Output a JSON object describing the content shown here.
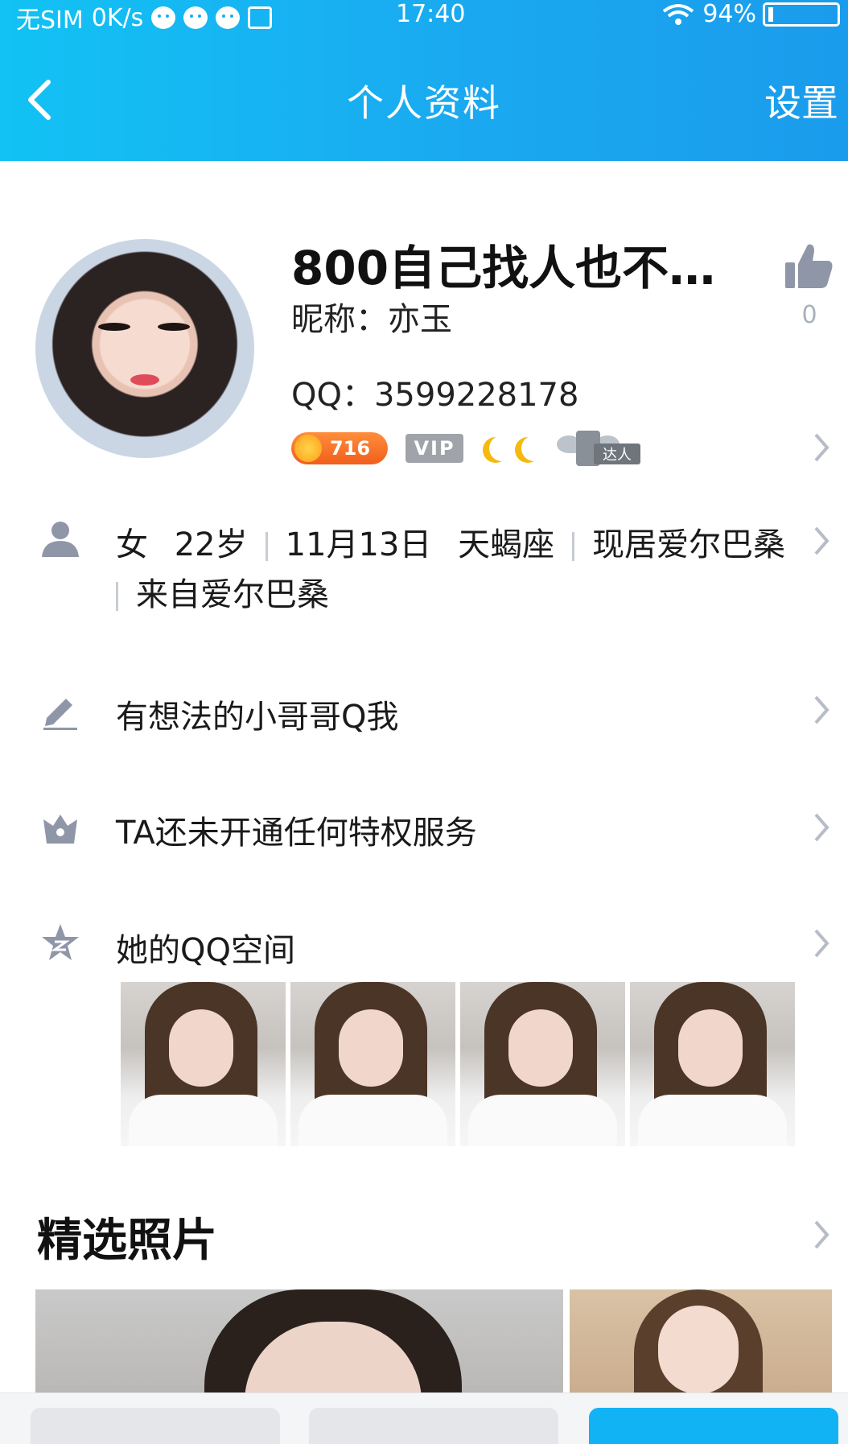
{
  "status_bar": {
    "carrier": "无SIM",
    "speed": "0K/s",
    "time": "17:40",
    "battery": "94%"
  },
  "nav": {
    "title": "个人资料",
    "settings_label": "设置"
  },
  "profile": {
    "display_name": "800自己找人也不…",
    "nickname": "昵称：亦玉",
    "qq": "QQ：3599228178",
    "like_count": "0",
    "level": "716",
    "vip": "VIP",
    "talent_tag": "达人"
  },
  "info": {
    "gender": "女",
    "age": "22岁",
    "birthday": "11月13日",
    "zodiac": "天蝎座",
    "location": "现居爱尔巴桑",
    "hometown": "来自爱尔巴桑"
  },
  "rows": {
    "signature": "有想法的小哥哥Q我",
    "privilege": "TA还未开通任何特权服务",
    "qzone": "她的QQ空间"
  },
  "featured": {
    "title": "精选照片"
  },
  "colors": {
    "header_start": "#12c2f4",
    "header_end": "#1a9cec",
    "icon_gray": "#8f96a8",
    "chevron": "#b7bdc6"
  }
}
